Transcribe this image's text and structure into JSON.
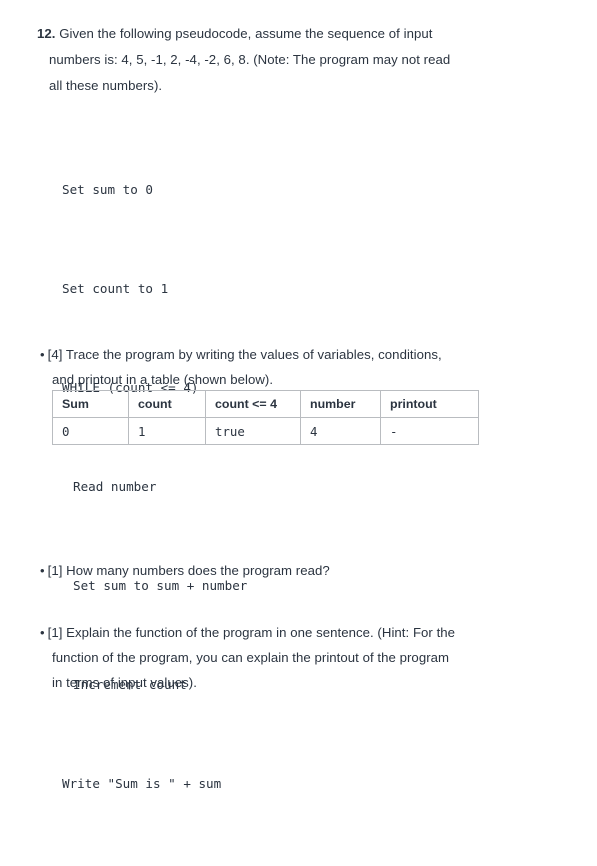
{
  "question": {
    "number": "12.",
    "line1": "Given the following pseudocode, assume the sequence of input",
    "line2": "numbers is: 4, 5, -1, 2, -4, -2, 6, 8. (Note: The program may not read",
    "line3": "all these numbers)."
  },
  "pseudocode": {
    "lines": [
      {
        "text": "Set sum to 0",
        "indent": 0
      },
      {
        "text": "Set count to 1",
        "indent": 0
      },
      {
        "text": "WHILE (count <= 4)",
        "indent": 0
      },
      {
        "text": "Read number",
        "indent": 1
      },
      {
        "text": "Set sum to sum + number",
        "indent": 1
      },
      {
        "text": "Increment count",
        "indent": 1
      },
      {
        "text": "Write \"Sum is \" + sum",
        "indent": 0
      }
    ]
  },
  "bullets": {
    "bullet_marker": "•",
    "trace": {
      "line1": "[4] Trace the program by writing the values of variables, conditions,",
      "line2": "and printout in a table (shown below)."
    },
    "howmany": {
      "line1": "[1] How many numbers does the program read?"
    },
    "explain": {
      "line1": "[1] Explain the function of the program in one sentence. (Hint: For the",
      "line2": "function of the program, you can explain the printout of the program",
      "line3": "in terms of input values)."
    }
  },
  "trace_table": {
    "headers": [
      "Sum",
      "count",
      "count <= 4",
      "number",
      "printout"
    ],
    "rows": [
      [
        "0",
        "1",
        "true",
        "4",
        "-"
      ]
    ]
  },
  "colors": {
    "text": "#2b3440",
    "table_border": "#b9bcc0",
    "background": "#ffffff"
  }
}
